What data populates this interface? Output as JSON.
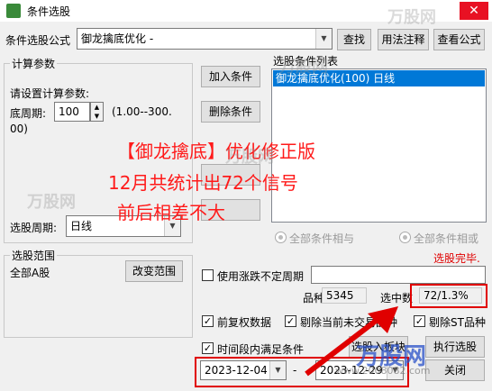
{
  "window": {
    "title": "条件选股",
    "close_glyph": "✕"
  },
  "formula": {
    "label": "条件选股公式",
    "value": "御龙擒底优化  -",
    "find_label": "查找",
    "usage_label": "用法注释",
    "view_label": "查看公式"
  },
  "params": {
    "group_title": "计算参数",
    "prompt": "请设置计算参数:",
    "bottom_period_label": "底周期:",
    "bottom_period_value": "100",
    "range_text": "(1.00--300.",
    "range_text_2": "00)",
    "period_label": "选股周期:",
    "period_value": "日线"
  },
  "conditions": {
    "add_label": "加入条件",
    "delete_label": "删除条件",
    "list_title": "选股条件列表",
    "items": [
      "御龙擒底优化(100) 日线"
    ],
    "radio_and": "全部条件相与",
    "radio_or": "全部条件相或",
    "status": "选股完毕."
  },
  "scope": {
    "group_title": "选股范围",
    "value": "全部A股",
    "change_label": "改变范围"
  },
  "options": {
    "use_variable_period": "使用涨跌不定周期",
    "count_label": "品种数",
    "count_value": "5345",
    "selected_label": "选中数",
    "selected_value": "72/1.3%",
    "forward_adjust": "前复权数据",
    "exclude_untraded": "剔除当前未交易品种",
    "exclude_st": "剔除ST品种",
    "time_range": "时间段内满足条件",
    "check_glyph": "✓",
    "start_date": "2023-12-04",
    "date_sep": "-",
    "end_date": "2023-12-29",
    "select_to_block": "选股入板块",
    "execute": "执行选股",
    "close": "关闭"
  },
  "overlay": {
    "line1": "【御龙擒底】优化修正版",
    "line2": "12月共统计出72个信号",
    "line3": "前后相差不大"
  },
  "watermarks": {
    "brand": "万股网",
    "url": "www.2008082.com"
  },
  "colors": {
    "accent": "#0078d7",
    "alert": "#e00000",
    "close": "#e81123"
  }
}
